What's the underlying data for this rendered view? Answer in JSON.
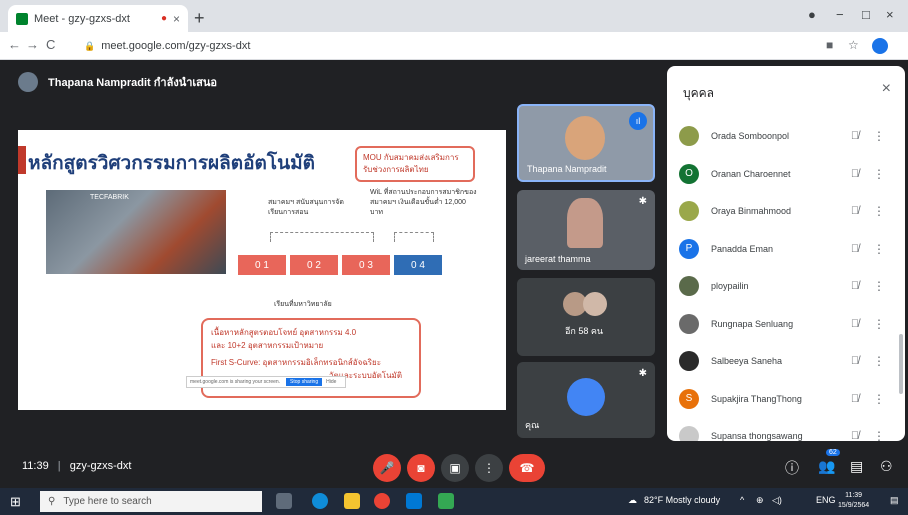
{
  "browser": {
    "tab_title": "Meet - gzy-gzxs-dxt",
    "tab_close": "×",
    "new_tab": "+",
    "url": "meet.google.com/gzy-gzxs-dxt",
    "window_minimize": "−",
    "window_maximize": "□",
    "window_close": "×"
  },
  "meeting": {
    "presenter_text": "Thapana Nampradit กำลังนำเสนอ",
    "code": "gzy-gzxs-dxt",
    "time": "11:39",
    "participant_count": "62"
  },
  "slide": {
    "title": "หลักสูตรวิศวกรรมการผลิตอัตโนมัติ",
    "mou_text": "MOU กับสมาคมส่งเสริมการรับช่วงการผลิตไทย",
    "factory_label": "TECFABRIK",
    "assoc_text": "สมาคมฯ สนับสนุนการจัดเรียนการสอน",
    "wil_text": "WiL ที่สถานประกอบการสมาชิกของสมาคมฯ เงินเดือนขั้นต่ำ 12,000 บาท",
    "boxes": [
      "0 1",
      "0 2",
      "0 3",
      "0 4"
    ],
    "study_label": "เรียนที่มหาวิทยาลัย",
    "note_lines": [
      "เนื้อหาหลักสูตรตอบโจทย์ อุตสาหกรรม 4.0",
      "และ 10+2 อุตสาหกรรมเป้าหมาย",
      "First S-Curve: อุตสาหกรรมอิเล็กทรอนิกส์อัจฉริยะ",
      "วัตและระบบอัตโนมัติ"
    ],
    "share_notice": "meet.google.com is sharing your screen.",
    "share_stop": "Stop sharing",
    "share_hide": "Hide"
  },
  "tiles": [
    {
      "name": "Thapana Nampradit"
    },
    {
      "name": "jareerat thamma"
    },
    {
      "name": "อีก 58 คน"
    },
    {
      "name": "คุณ"
    }
  ],
  "people_panel": {
    "title": "บุคคล",
    "close": "×",
    "people": [
      {
        "name": "Orada Somboonpol",
        "initial": "",
        "color": "#8d9b4a"
      },
      {
        "name": "Oranan Charoennet",
        "initial": "O",
        "color": "#137333"
      },
      {
        "name": "Oraya Binmahmood",
        "initial": "",
        "color": "#9aa84a"
      },
      {
        "name": "Panadda Eman",
        "initial": "P",
        "color": "#1a73e8"
      },
      {
        "name": "ploypailin",
        "initial": "",
        "color": "#5a6a4a"
      },
      {
        "name": "Rungnapa Senluang",
        "initial": "",
        "color": "#6a6a6a"
      },
      {
        "name": "Salbeeya Saneha",
        "initial": "",
        "color": "#2a2a2a"
      },
      {
        "name": "Supakjira ThangThong",
        "initial": "S",
        "color": "#e8710a"
      },
      {
        "name": "Supansa thongsawang",
        "initial": "",
        "color": "#c9c9c9"
      }
    ]
  },
  "taskbar": {
    "search_placeholder": "Type here to search",
    "weather": "82°F  Mostly cloudy",
    "lang": "ENG",
    "clock_time": "11:39",
    "clock_date": "15/9/2564"
  }
}
